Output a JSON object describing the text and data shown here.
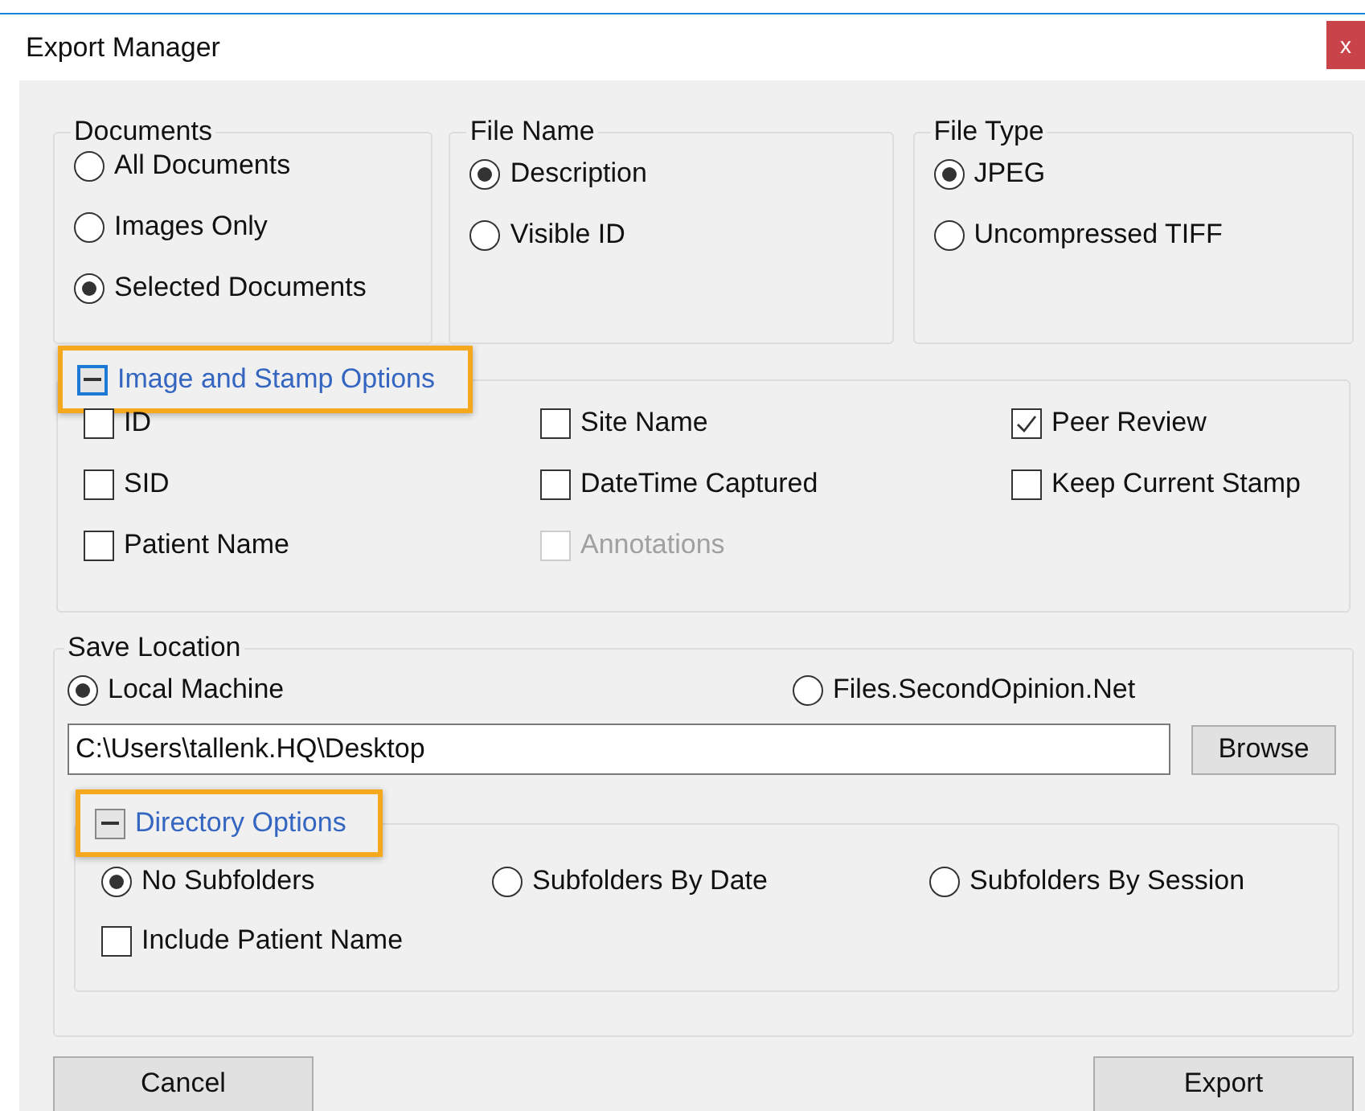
{
  "window": {
    "title": "Export Manager",
    "close_label": "x"
  },
  "documents": {
    "title": "Documents",
    "options": [
      {
        "label": "All Documents",
        "selected": false
      },
      {
        "label": "Images Only",
        "selected": false
      },
      {
        "label": "Selected Documents",
        "selected": true
      }
    ]
  },
  "file_name": {
    "title": "File Name",
    "options": [
      {
        "label": "Description",
        "selected": true
      },
      {
        "label": "Visible ID",
        "selected": false
      }
    ]
  },
  "file_type": {
    "title": "File Type",
    "options": [
      {
        "label": "JPEG",
        "selected": true
      },
      {
        "label": "Uncompressed TIFF",
        "selected": false
      }
    ]
  },
  "image_stamp_options": {
    "title": "Image and Stamp Options",
    "expanded": true,
    "highlighted": true,
    "items": [
      {
        "label": "ID",
        "checked": false,
        "disabled": false
      },
      {
        "label": "Site Name",
        "checked": false,
        "disabled": false
      },
      {
        "label": "Peer Review",
        "checked": true,
        "disabled": false
      },
      {
        "label": "SID",
        "checked": false,
        "disabled": false
      },
      {
        "label": "DateTime Captured",
        "checked": false,
        "disabled": false
      },
      {
        "label": "Keep Current Stamp",
        "checked": false,
        "disabled": false
      },
      {
        "label": "Patient Name",
        "checked": false,
        "disabled": false
      },
      {
        "label": "Annotations",
        "checked": false,
        "disabled": true
      }
    ]
  },
  "save_location": {
    "title": "Save Location",
    "destinations": [
      {
        "label": "Local Machine",
        "selected": true
      },
      {
        "label": "Files.SecondOpinion.Net",
        "selected": false
      }
    ],
    "path": "C:\\Users\\tallenk.HQ\\Desktop",
    "browse_label": "Browse",
    "directory_options": {
      "title": "Directory Options",
      "expanded": true,
      "highlighted": true,
      "subfolders": [
        {
          "label": "No Subfolders",
          "selected": true
        },
        {
          "label": "Subfolders By Date",
          "selected": false
        },
        {
          "label": "Subfolders By Session",
          "selected": false
        }
      ],
      "include_patient_name": {
        "label": "Include Patient Name",
        "checked": false
      }
    }
  },
  "buttons": [
    {
      "label": "Cancel"
    },
    {
      "label": "Export"
    }
  ]
}
